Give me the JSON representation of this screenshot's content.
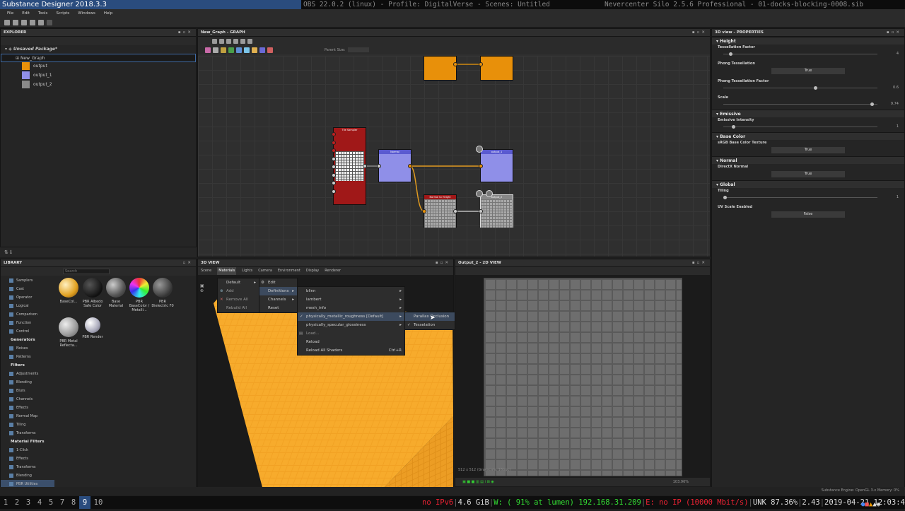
{
  "titles": {
    "substance": "Substance Designer 2018.3.3",
    "obs": "OBS 22.0.2 (linux) - Profile: DigitalVerse - Scenes: Untitled",
    "silo": "Nevercenter Silo 2.5.6 Professional - 01-docks-blocking-0008.sib"
  },
  "menubar": [
    "File",
    "Edit",
    "Tools",
    "Scripts",
    "Windows",
    "Help"
  ],
  "explorer": {
    "title": "EXPLORER",
    "package": "Unsaved Package*",
    "graph": "New_Graph",
    "outputs": [
      {
        "label": "output",
        "color": "#e8900a"
      },
      {
        "label": "output_1",
        "color": "#8f8fe8"
      },
      {
        "label": "output_2",
        "color": "#8a8a8a"
      }
    ]
  },
  "graph": {
    "title": "New_Graph - GRAPH",
    "parent_size_label": "Parent Size:",
    "nodes": {
      "tile": "Tile Sampler",
      "normal": "Normal",
      "output1": "output_1",
      "nth": "Normal to Height",
      "output2": "output_2"
    }
  },
  "properties": {
    "title": "3D view - PROPERTIES",
    "sections": {
      "height": "Height",
      "emissive": "Emissive",
      "base_color": "Base Color",
      "normal": "Normal",
      "global": "Global"
    },
    "tess_factor": {
      "label": "Tessellation Factor",
      "value": "4"
    },
    "phong": {
      "label": "Phong Tessellation",
      "value": "True"
    },
    "phong_factor": {
      "label": "Phong Tessellation Factor",
      "value": "0.6"
    },
    "scale": {
      "label": "Scale",
      "value": "9.74"
    },
    "emissive_int": {
      "label": "Emissive Intensity",
      "value": "1"
    },
    "srgb": {
      "label": "sRGB Base Color Texture",
      "value": "True"
    },
    "directx": {
      "label": "DirectX Normal",
      "value": "True"
    },
    "tiling": {
      "label": "Tiling",
      "value": "1"
    },
    "uv_scale": {
      "label": "UV Scale Enabled",
      "value": "False"
    }
  },
  "library": {
    "title": "LIBRARY",
    "search_placeholder": "Search",
    "categories1": [
      "Samplers",
      "Cast",
      "Operator",
      "Logical",
      "Comparison",
      "Function",
      "Control"
    ],
    "gen_header": "Generators",
    "categories2": [
      "Noises",
      "Patterns"
    ],
    "filters_header": "Filters",
    "categories3": [
      "Adjustments",
      "Blending",
      "Blurs",
      "Channels",
      "Effects",
      "Normal Map",
      "Tiling",
      "Transforms"
    ],
    "matfilters_header": "Material Filters",
    "categories4": [
      "1-Click",
      "Effects",
      "Transforms",
      "Blending",
      "PBR Utilities"
    ],
    "materials": [
      {
        "label": "BaseCol..."
      },
      {
        "label": "PBR Albedo Safe Color"
      },
      {
        "label": "Base Material"
      },
      {
        "label": "PBR BaseColor / Metalli..."
      },
      {
        "label": "PBR Dielectric F0"
      },
      {
        "label": "PBR Metal Reflecta..."
      },
      {
        "label": "PBR Render"
      }
    ]
  },
  "view3d": {
    "title": "3D VIEW",
    "tabs": [
      "Scene",
      "Materials",
      "Lights",
      "Camera",
      "Environment",
      "Display",
      "Renderer"
    ],
    "menu1": [
      "Default",
      "Add",
      "Remove All",
      "Rebuild All"
    ],
    "menu2": [
      "Edit",
      "Definitions",
      "Channels",
      "Reset"
    ],
    "menu3": [
      "blinn",
      "lambert",
      "mesh_info",
      "physically_metallic_roughness [Default]",
      "physically_specular_glossiness",
      "Load...",
      "Reload",
      "Reload All Shaders"
    ],
    "shortcut": "Ctrl+R",
    "menu4": [
      "Parallax Occlusion",
      "Tesselation"
    ]
  },
  "view2d": {
    "title": "Output_2 - 2D VIEW",
    "info": "512 x 512 (Grayscale, 16bpc)",
    "zoom": "103.96%"
  },
  "status": {
    "engine": "Substance Engine: OpenGL 3.x  Memory: 0%"
  },
  "taskbar": {
    "workspaces": [
      "1",
      "2",
      "3",
      "4",
      "5",
      "7",
      "8",
      "9",
      "10"
    ],
    "active": "9",
    "ipv6": "no IPv6",
    "mem": "4.6 GiB",
    "wifi": "W: ( 91% at lumen) 192.168.31.209",
    "eth": "E: no IP (10000 Mbit/s)",
    "bat": "UNK 87.36%",
    "load": "2.43",
    "clock": "2019-04-21 12:03:45"
  }
}
